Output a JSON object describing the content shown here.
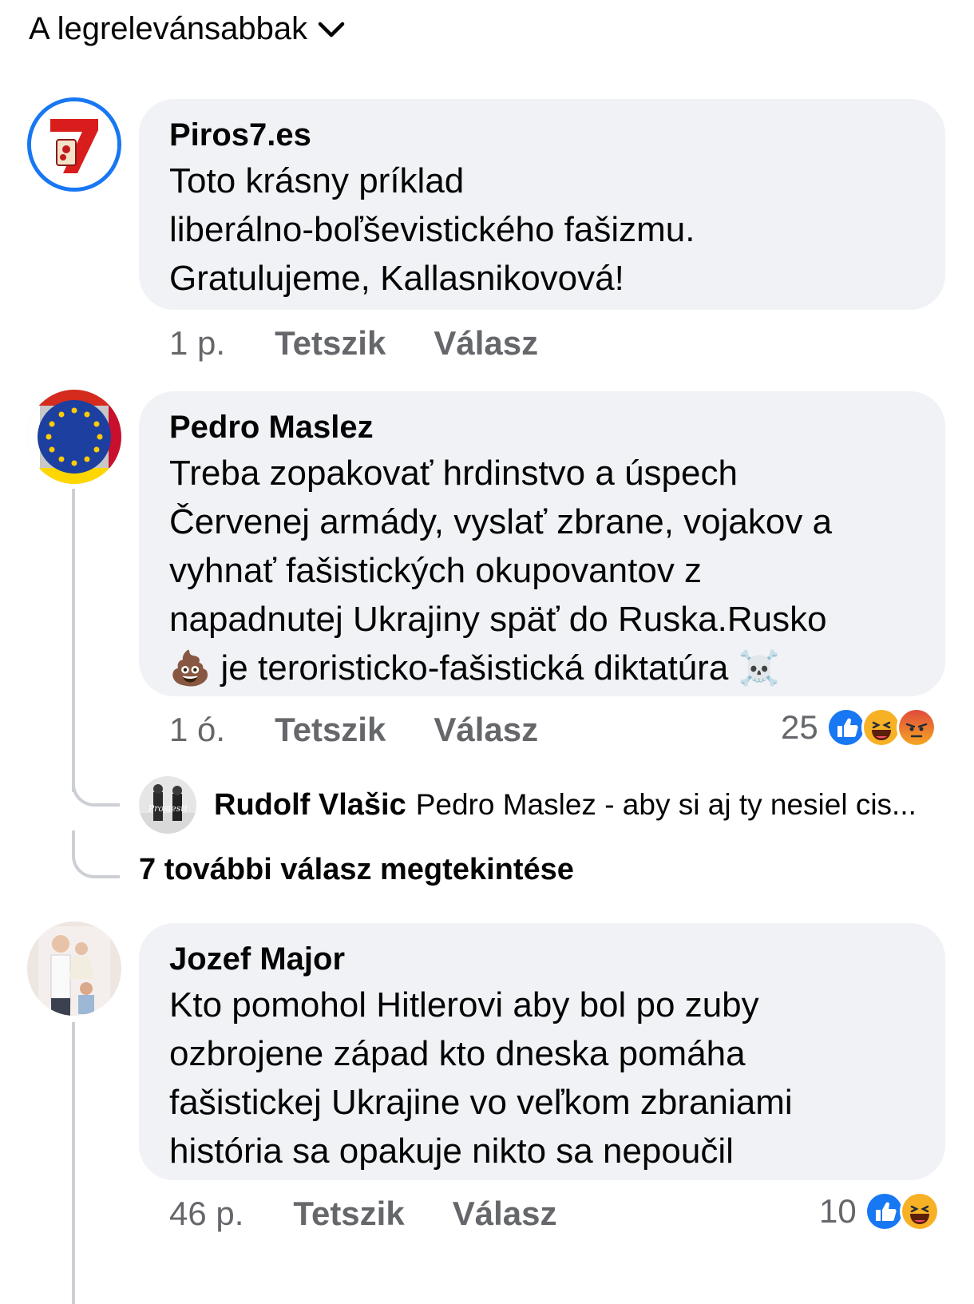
{
  "sort": {
    "label": "A legrelevánsabbak",
    "icon": "chevron-down-icon"
  },
  "comments": [
    {
      "author": "Piros7.es",
      "lines": [
        "Toto krásny príklad",
        "liberálno-boľševistického fašizmu.",
        "Gratulujeme, Kallasnikovová!"
      ],
      "time": "1 p.",
      "like": "Tetszik",
      "reply": "Válasz"
    },
    {
      "author": "Pedro Maslez",
      "lines": [
        "Treba zopakovať hrdinstvo a úspech",
        "Červenej armády, vyslať zbrane, vojakov a",
        "vyhnať fašistických okupovantov z",
        "napadnutej Ukrajiny späť do Ruska.Rusko"
      ],
      "line5_emoji_1": "💩",
      "line5_text": " je teroristicko-fašistická diktatúra ",
      "line5_emoji_2": "☠️",
      "time": "1 ó.",
      "like": "Tetszik",
      "reply": "Válasz",
      "reaction_count": "25",
      "reactions": [
        "like",
        "haha",
        "angry"
      ],
      "reply_preview": {
        "author": "Rudolf Vlašic",
        "snippet": "Pedro Maslez - aby si aj ty nesiel cis...",
        "avatar_text": "Prosiesti"
      },
      "more_replies": "7 további válasz megtekintése"
    },
    {
      "author": "Jozef Major",
      "lines": [
        "Kto pomohol Hitlerovi aby bol po zuby",
        "ozbrojene západ kto dneska pomáha",
        "fašistickej Ukrajine vo veľkom zbraniami",
        "história sa opakuje nikto sa nepoučil"
      ],
      "time": "46 p.",
      "like": "Tetszik",
      "reply": "Válasz",
      "reaction_count": "10",
      "reactions": [
        "like",
        "haha"
      ]
    }
  ],
  "colors": {
    "bubble": "#f0f2f5",
    "secondary_text": "#65676b",
    "like_blue": "#1877f2",
    "haha_yellow": "#f7b125",
    "angry_red": "#e9710f"
  }
}
